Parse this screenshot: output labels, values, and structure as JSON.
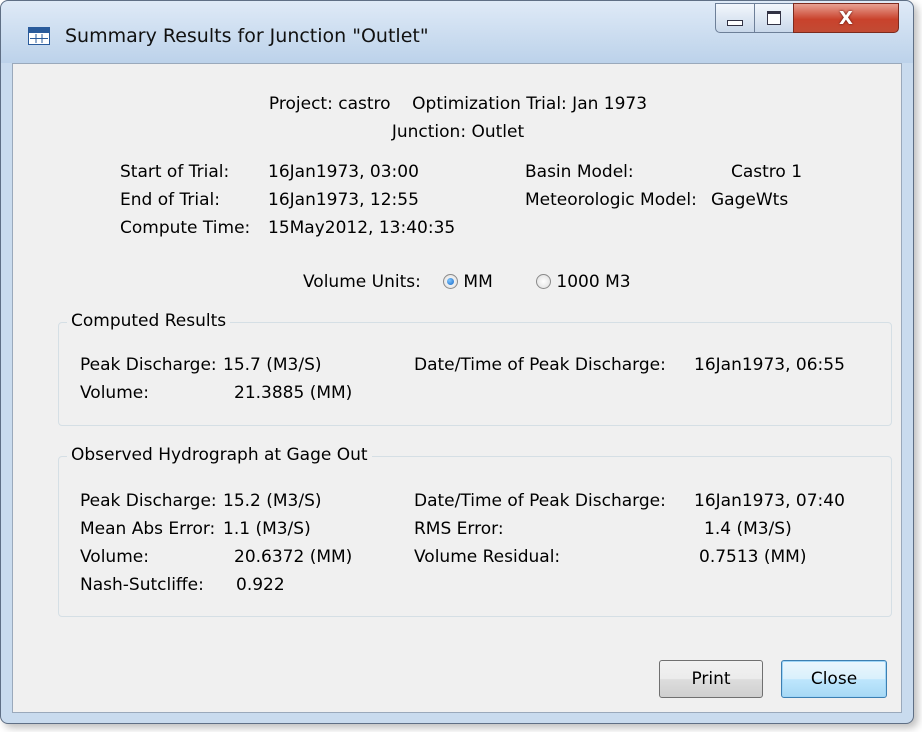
{
  "window": {
    "title": "Summary Results for Junction \"Outlet\"",
    "icon": "table-icon",
    "close_glyph": "X"
  },
  "header": {
    "project": "Project: castro",
    "trial": "Optimization Trial: Jan 1973",
    "junction": "Junction: Outlet"
  },
  "trial_info": {
    "start_label": "Start of Trial:",
    "start_value": "16Jan1973, 03:00",
    "end_label": "End of Trial:",
    "end_value": "16Jan1973, 12:55",
    "compute_label": "Compute Time:",
    "compute_value": "15May2012, 13:40:35",
    "basin_label": "Basin Model:",
    "basin_value": "Castro 1",
    "met_label": "Meteorologic Model:",
    "met_value": "GageWts"
  },
  "volume_units": {
    "label": "Volume Units:",
    "options": [
      "MM",
      "1000 M3"
    ],
    "selected": "MM"
  },
  "computed": {
    "title": "Computed Results",
    "peak_label": "Peak Discharge:",
    "peak_value": "15.7 (M3/S)",
    "volume_label": "Volume:",
    "volume_value": "21.3885 (MM)",
    "peak_time_label": "Date/Time of Peak Discharge:",
    "peak_time_value": "16Jan1973, 06:55"
  },
  "observed": {
    "title": "Observed Hydrograph at Gage Out",
    "peak_label": "Peak Discharge:",
    "peak_value": "15.2 (M3/S)",
    "mae_label": "Mean Abs Error:",
    "mae_value": "1.1 (M3/S)",
    "volume_label": "Volume:",
    "volume_value": "20.6372 (MM)",
    "nash_label": "Nash-Sutcliffe:",
    "nash_value": "0.922",
    "peak_time_label": "Date/Time of Peak Discharge:",
    "peak_time_value": "16Jan1973, 07:40",
    "rms_label": "RMS Error:",
    "rms_value": "1.4 (M3/S)",
    "residual_label": "Volume Residual:",
    "residual_value": "0.7513 (MM)"
  },
  "buttons": {
    "print": "Print",
    "close": "Close"
  }
}
